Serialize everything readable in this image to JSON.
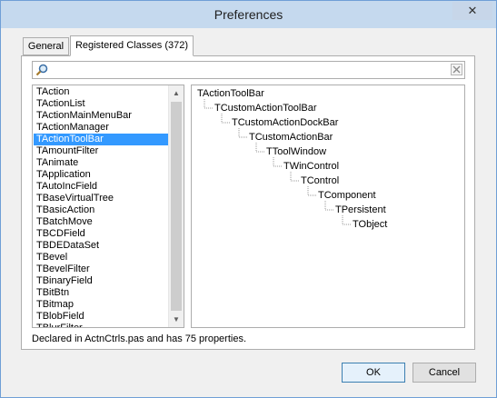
{
  "window": {
    "title": "Preferences",
    "close_label": "✕"
  },
  "tabs": [
    {
      "label": "General"
    },
    {
      "label": "Registered Classes (372)"
    }
  ],
  "search": {
    "value": ""
  },
  "class_list": {
    "selected_index": 4,
    "scroll_up": "▲",
    "scroll_down": "▼",
    "items": [
      "TAction",
      "TActionList",
      "TActionMainMenuBar",
      "TActionManager",
      "TActionToolBar",
      "TAmountFilter",
      "TAnimate",
      "TApplication",
      "TAutoIncField",
      "TBaseVirtualTree",
      "TBasicAction",
      "TBatchMove",
      "TBCDField",
      "TBDEDataSet",
      "TBevel",
      "TBevelFilter",
      "TBinaryField",
      "TBitBtn",
      "TBitmap",
      "TBlobField",
      "TBlurFilter"
    ]
  },
  "hierarchy": [
    "TActionToolBar",
    "TCustomActionToolBar",
    "TCustomActionDockBar",
    "TCustomActionBar",
    "TToolWindow",
    "TWinControl",
    "TControl",
    "TComponent",
    "TPersistent",
    "TObject"
  ],
  "status": "Declared in ActnCtrls.pas and has 75 properties.",
  "buttons": {
    "ok": "OK",
    "cancel": "Cancel"
  }
}
